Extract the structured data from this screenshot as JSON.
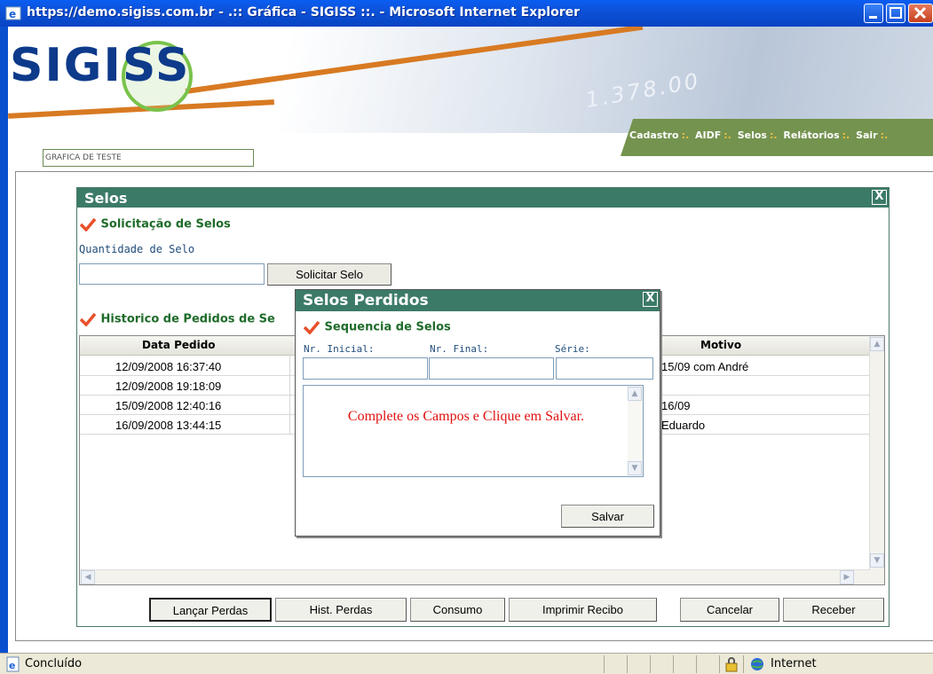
{
  "window": {
    "title": "https://demo.sigiss.com.br - .:: Gráfica - SIGISS ::. - Microsoft Internet Explorer"
  },
  "header": {
    "logo": "SIGISS",
    "nav": [
      "Cadastro",
      "AIDF",
      "Selos",
      "Relátorios",
      "Sair"
    ],
    "company": "GRAFICA DE TESTE"
  },
  "selos": {
    "title": "Selos",
    "close_label": "X",
    "solicitacao_title": "Solicitação de Selos",
    "quantidade_label": "Quantidade de Selo",
    "quantidade_value": "",
    "solicitar_label": "Solicitar Selo",
    "historico_title": "Historico de Pedidos de Se",
    "table": {
      "columns": [
        "Data Pedido",
        "Motivo"
      ],
      "rows": [
        {
          "data": "12/09/2008 16:37:40",
          "motivo": "15/09 com André"
        },
        {
          "data": "12/09/2008 19:18:09",
          "motivo": ""
        },
        {
          "data": "15/09/2008 12:40:16",
          "motivo": "16/09"
        },
        {
          "data": "16/09/2008 13:44:15",
          "motivo": "Eduardo"
        }
      ]
    },
    "buttons": [
      "Lançar Perdas",
      "Hist. Perdas",
      "Consumo",
      "Imprimir Recibo",
      "Cancelar",
      "Receber"
    ]
  },
  "perdidos": {
    "title": "Selos Perdidos",
    "close_label": "X",
    "section": "Sequencia de Selos",
    "fields": {
      "inicial_label": "Nr. Inicial:",
      "final_label": "Nr. Final:",
      "serie_label": "Série:"
    },
    "message": "Complete os Campos e Clique em Salvar.",
    "salvar_label": "Salvar"
  },
  "status": {
    "text": "Concluído",
    "zone": "Internet"
  },
  "colors": {
    "window_title": "#3c7a68",
    "section_title": "#1f6b2a",
    "message": "#e01010",
    "nav_bar": "#74934f"
  }
}
